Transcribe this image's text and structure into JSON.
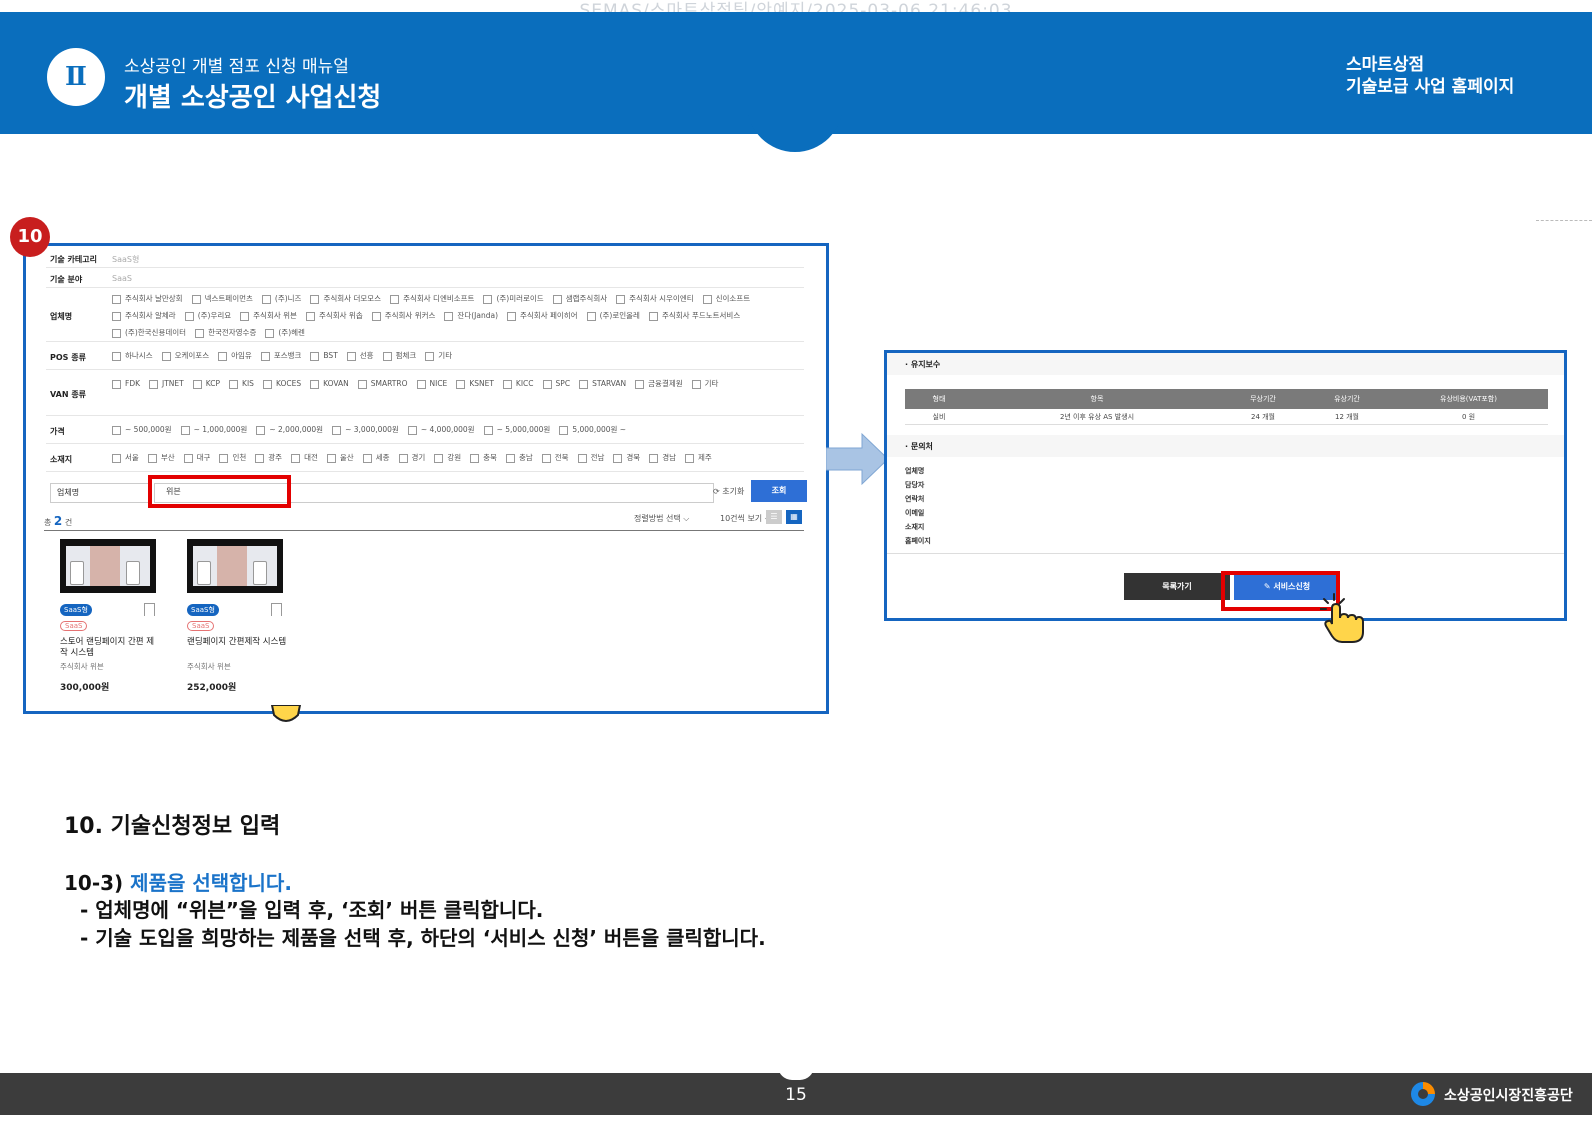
{
  "watermark": "SEMAS/스마트상점팀/안예지/2025-03-06 21:46:03",
  "header": {
    "chapter_numeral": "Ⅱ",
    "subtitle": "소상공인 개별 점포 신청 매뉴얼",
    "title": "개별 소상공인 사업신청",
    "right_line1": "스마트상점",
    "right_line2": "기술보급 사업 홈페이지"
  },
  "step_badge": "10",
  "search_form": {
    "rows": [
      {
        "label": "기술 카테고리",
        "value": "SaaS형"
      },
      {
        "label": "기술 분야",
        "value": "SaaS"
      },
      {
        "label": "업체명",
        "options": [
          "주식회사 날만상회",
          "넥스트페이먼츠",
          "(주)니즈",
          "주식회사 더모모스",
          "주식회사 디엔비소프트",
          "(주)미러로이드",
          "샘랩주식회사",
          "주식회사 시우이엔티",
          "신이소프트",
          "주식회사 알체라",
          "(주)우리요",
          "주식회사 위븐",
          "주식회사 위솝",
          "주식회사 위커스",
          "잔다(Janda)",
          "주식회사 페이히어",
          "(주)로인올레",
          "주식회사 푸드노트서비스",
          "(주)한국신용데이터",
          "한국전자영수증",
          "(주)헤렌"
        ]
      },
      {
        "label": "POS 종류",
        "options": [
          "하나시스",
          "오케이포스",
          "아임유",
          "포스뱅크",
          "BST",
          "선흥",
          "펌체크",
          "기타"
        ]
      },
      {
        "label": "VAN 종류",
        "options": [
          "FDK",
          "JTNET",
          "KCP",
          "KIS",
          "KOCES",
          "KOVAN",
          "SMARTRO",
          "NICE",
          "KSNET",
          "KICC",
          "SPC",
          "STARVAN",
          "금융결제원",
          "기타"
        ]
      },
      {
        "label": "가격",
        "options": [
          "~ 500,000원",
          "~ 1,000,000원",
          "~ 2,000,000원",
          "~ 3,000,000원",
          "~ 4,000,000원",
          "~ 5,000,000원",
          "5,000,000원 ~"
        ]
      },
      {
        "label": "소재지",
        "options": [
          "서울",
          "부산",
          "대구",
          "인천",
          "광주",
          "대전",
          "울산",
          "세종",
          "경기",
          "강원",
          "충북",
          "충남",
          "전북",
          "전남",
          "경북",
          "경남",
          "제주"
        ]
      }
    ],
    "select_value": "업체명",
    "query": "위븐",
    "reset_label": "⟳ 초기화",
    "search_button": "조회",
    "count_prefix": "총",
    "count": "2",
    "count_suffix": "건",
    "sort_label": "정렬방법 선택",
    "per_page_label": "10건씩 보기"
  },
  "products": [
    {
      "tag1": "SaaS형",
      "tag2": "SaaS",
      "name": "스토어 랜딩페이지 간편 제작 시스템",
      "company": "주식회사 위븐",
      "price": "300,000원"
    },
    {
      "tag1": "SaaS형",
      "tag2": "SaaS",
      "name": "랜딩페이지 간편제작 시스템",
      "company": "주식회사 위븐",
      "price": "252,000원"
    }
  ],
  "detail": {
    "maint_title": "유지보수",
    "table_headers": [
      "형태",
      "항목",
      "무상기간",
      "유상기간",
      "유상비용(VAT포함)"
    ],
    "table_row": [
      "실비",
      "2년 이후 유상 AS 발생시",
      "24 개월",
      "12 개월",
      "0 원"
    ],
    "contact_title": "문의처",
    "contact_fields": [
      "업체명",
      "담당자",
      "연락처",
      "이메일",
      "소재지",
      "홈페이지"
    ],
    "list_button": "목록가기",
    "apply_button": "✎ 서비스신청"
  },
  "caption": {
    "title": "10. 기술신청정보 입력",
    "step_prefix": "10-3)",
    "step_text": "제품을 선택합니다.",
    "line1": "- 업체명에 “위븐”을 입력 후, ‘조회’ 버튼 클릭합니다.",
    "line2": "- 기술 도입을 희망하는 제품을 선택 후, 하단의 ‘서비스 신청’ 버튼을 클릭합니다."
  },
  "footer": {
    "page_number": "15",
    "org_name": "소상공인시장진흥공단"
  },
  "colors": {
    "brand_blue": "#0a6ebd",
    "highlight_red": "#e30000",
    "footer_gray": "#3c3c3c",
    "step_blue": "#1a73c9"
  }
}
